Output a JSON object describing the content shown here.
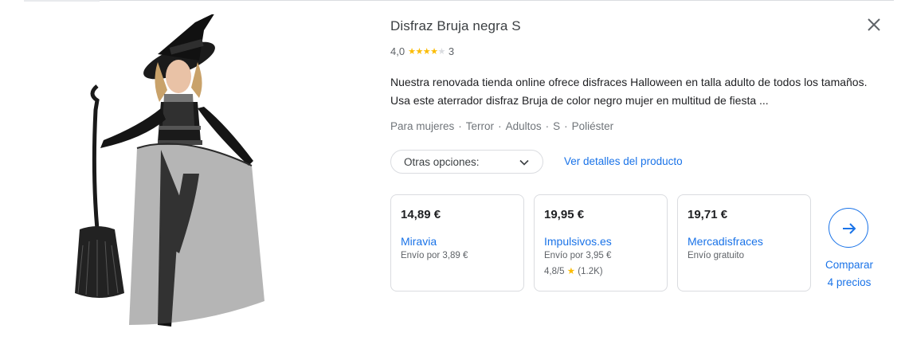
{
  "product": {
    "title": "Disfraz Bruja negra S",
    "rating_value": "4,0",
    "rating_stars": 4,
    "review_count": "3",
    "description_line1": "Nuestra renovada tienda online ofrece disfraces Halloween en talla adulto de todos los tamaños.",
    "description_line2": "Usa este aterrador disfraz Bruja de color negro mujer en multitud de fiesta ...",
    "attributes": [
      "Para mujeres",
      "Terror",
      "Adultos",
      "S",
      "Poliéster"
    ]
  },
  "controls": {
    "options_label": "Otras opciones:",
    "details_link": "Ver detalles del producto",
    "compare_line1": "Comparar",
    "compare_line2": "4 precios"
  },
  "offers": [
    {
      "price": "14,89 €",
      "store": "Miravia",
      "shipping": "Envío por 3,89 €",
      "store_rating": ""
    },
    {
      "price": "19,95 €",
      "store": "Impulsivos.es",
      "shipping": "Envío por 3,95 €",
      "store_rating": "4,8/5",
      "store_rating_count": "(1.2K)"
    },
    {
      "price": "19,71 €",
      "store": "Mercadisfraces",
      "shipping": "Envío gratuito",
      "store_rating": ""
    }
  ],
  "icons": {
    "close": "close-icon",
    "chevron": "chevron-down-icon",
    "compare": "arrow-right-icon"
  },
  "colors": {
    "link": "#1a73e8",
    "star": "#fbbc04",
    "border": "#dadce0"
  }
}
